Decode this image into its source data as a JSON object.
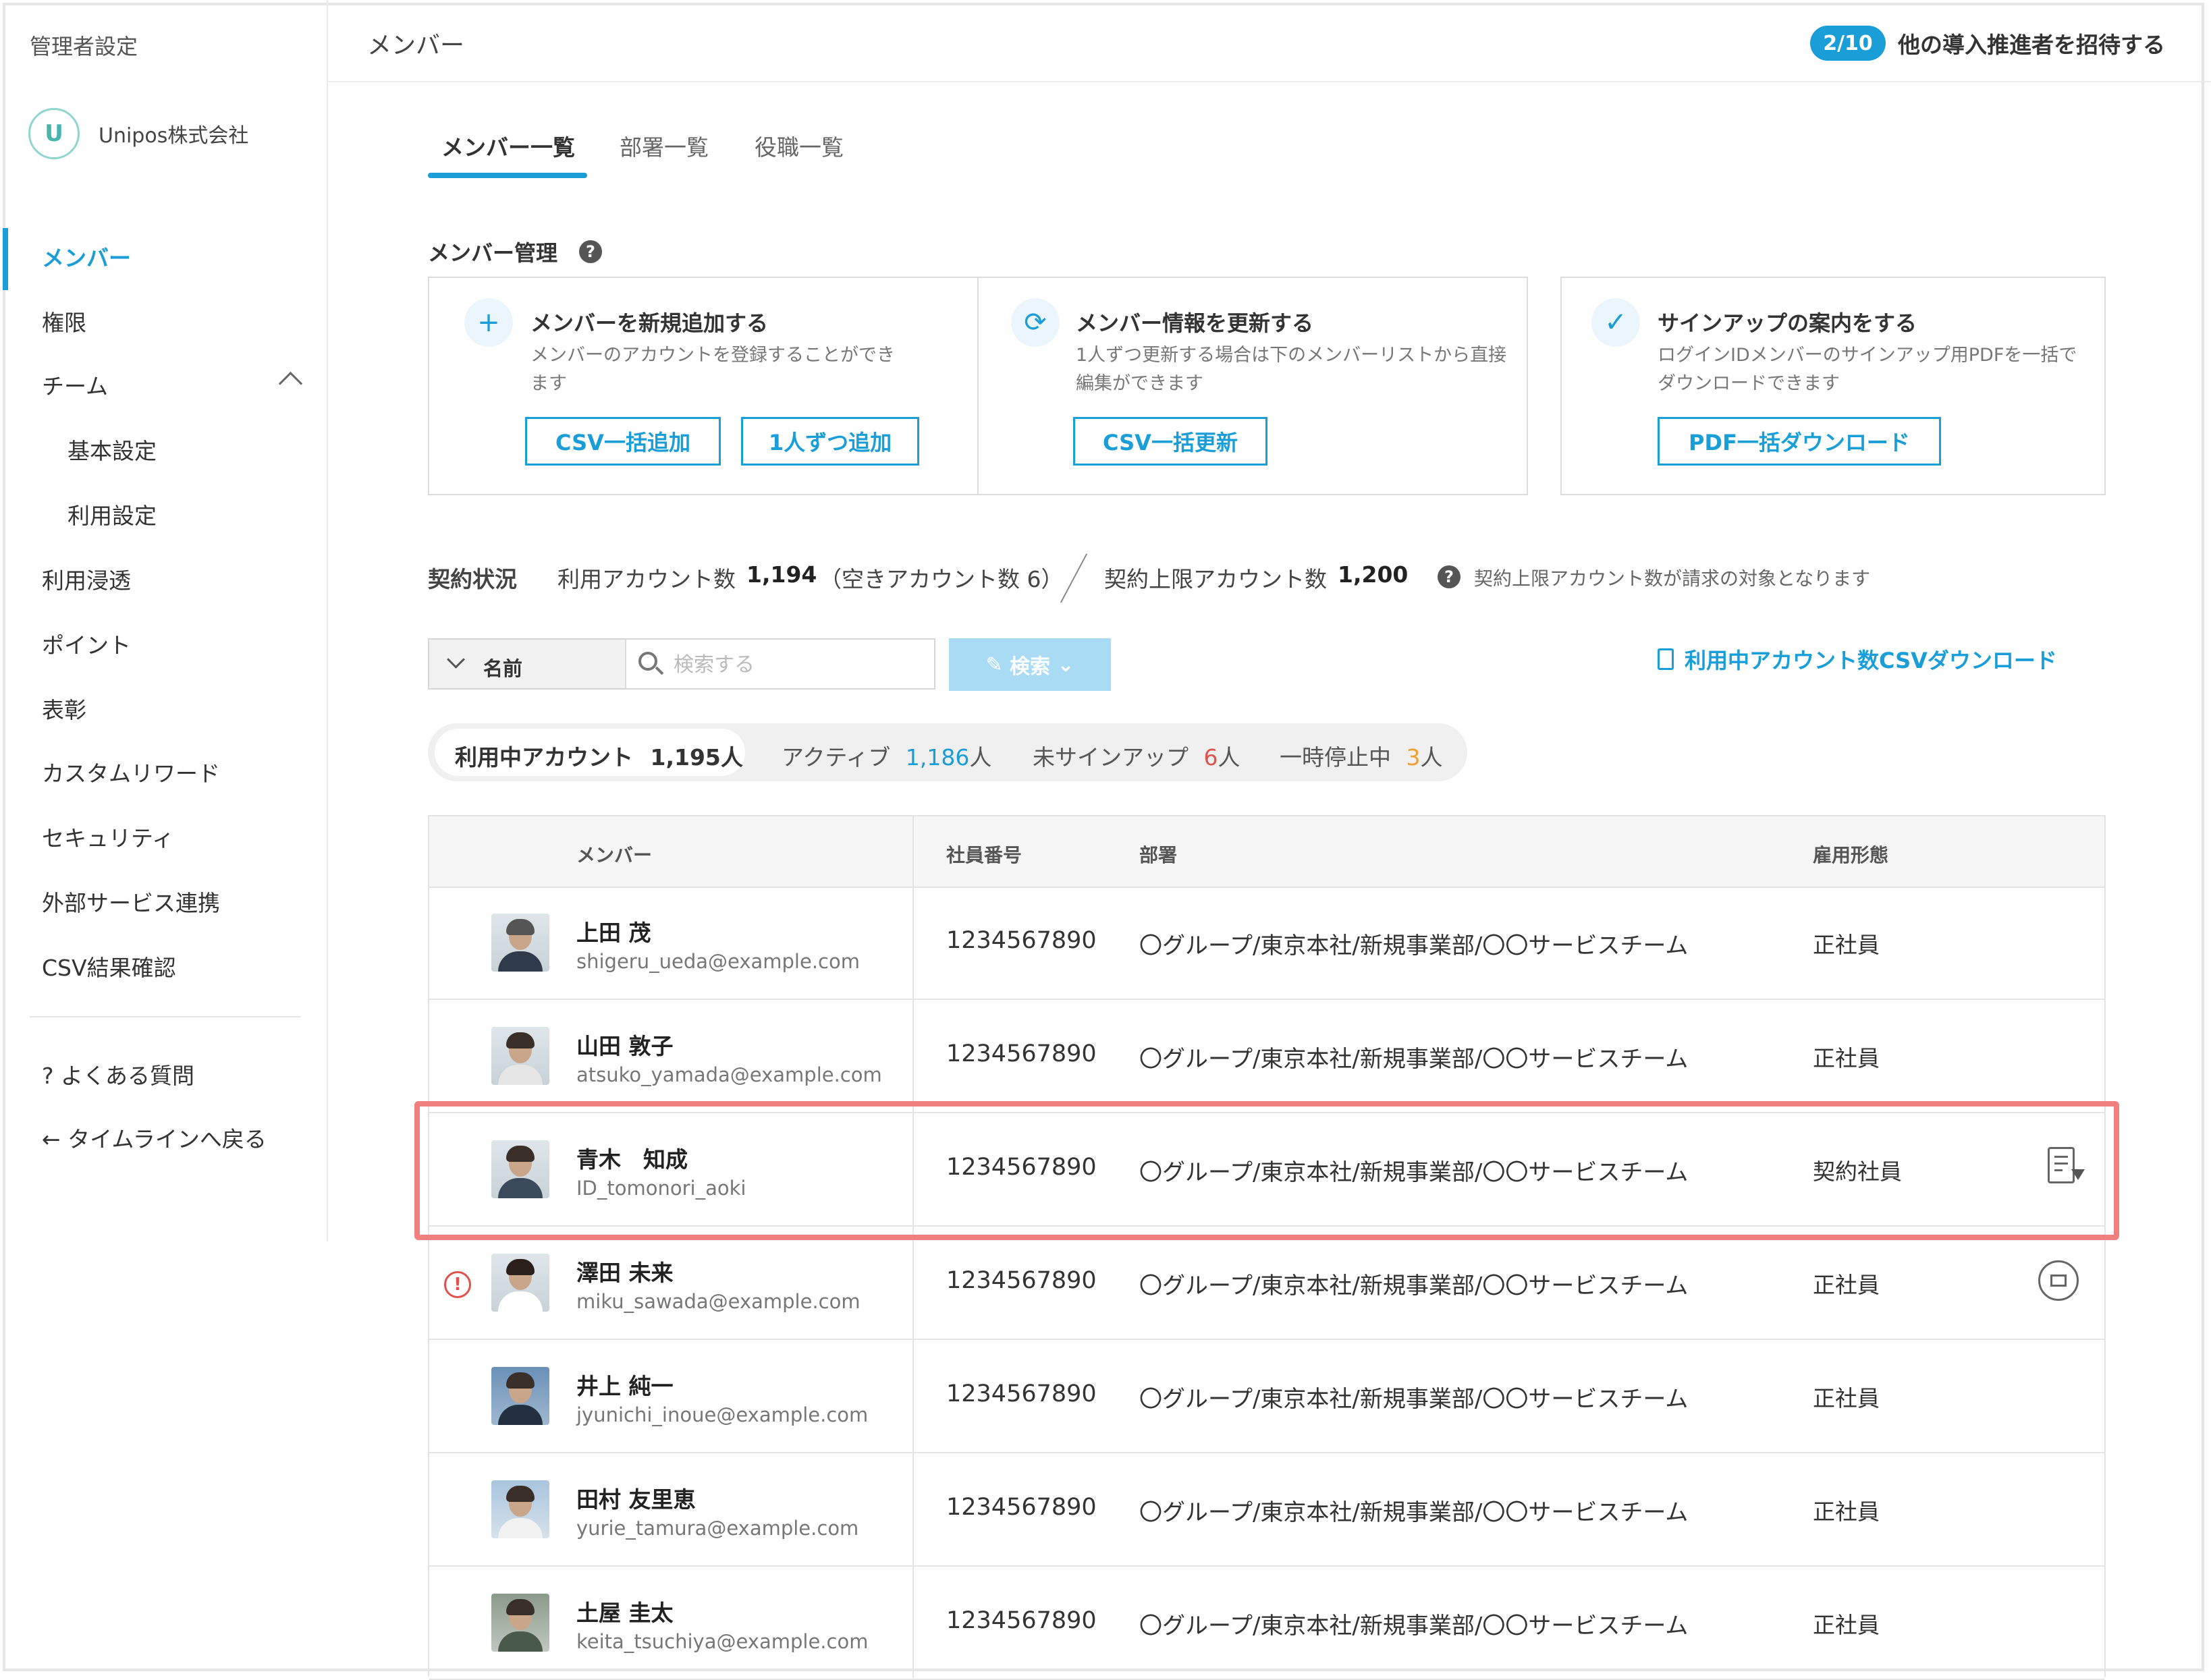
{
  "sidebar": {
    "title": "管理者設定",
    "org_logo": "U",
    "org_name": "Unipos株式会社",
    "items": [
      {
        "label": "メンバー"
      },
      {
        "label": "権限"
      },
      {
        "label": "チーム"
      },
      {
        "label": "基本設定"
      },
      {
        "label": "利用設定"
      },
      {
        "label": "利用浸透"
      },
      {
        "label": "ポイント"
      },
      {
        "label": "表彰"
      },
      {
        "label": "カスタムリワード"
      },
      {
        "label": "セキュリティ"
      },
      {
        "label": "外部サービス連携"
      },
      {
        "label": "CSV結果確認"
      }
    ],
    "faq": "? よくある質問",
    "back": "← タイムラインへ戻る"
  },
  "header": {
    "title": "メンバー",
    "badge": "2/10",
    "invite": "他の導入推進者を招待する"
  },
  "tabs": [
    "メンバー一覧",
    "部署一覧",
    "役職一覧"
  ],
  "management": {
    "label": "メンバー管理",
    "help": "?",
    "cards": [
      {
        "icon": "+",
        "title": "メンバーを新規追加する",
        "desc": "メンバーのアカウントを登録することができます",
        "buttons": [
          "CSV一括追加",
          "1人ずつ追加"
        ]
      },
      {
        "icon": "⟳",
        "title": "メンバー情報を更新する",
        "desc": "1人ずつ更新する場合は下のメンバーリストから直接編集ができます",
        "buttons": [
          "CSV一括更新"
        ]
      },
      {
        "icon": "✓",
        "title": "サインアップの案内をする",
        "desc": "ログインIDメンバーのサインアップ用PDFを一括でダウンロードできます",
        "buttons": [
          "PDF一括ダウンロード"
        ]
      }
    ]
  },
  "contract": {
    "label": "契約状況",
    "used": "利用アカウント数",
    "used_count": "1,194",
    "free": "（空きアカウント数 6）",
    "limit": "契約上限アカウント数",
    "limit_count": "1,200",
    "help": "?",
    "note": "契約上限アカウント数が請求の対象となります"
  },
  "search": {
    "field": "名前",
    "placeholder": "検索する",
    "button": "検索",
    "download": "利用中アカウント数CSVダウンロード"
  },
  "filters": {
    "in_use_label": "利用中アカウント",
    "in_use_count": "1,195人",
    "active_label": "アクティブ",
    "active_count": "1,186",
    "unsigned_label": "未サインアップ",
    "unsigned_count": "6",
    "paused_label": "一時停止中",
    "paused_count": "3",
    "unit": "人"
  },
  "table": {
    "headers": {
      "member": "メンバー",
      "id": "社員番号",
      "dept": "部署",
      "emp": "雇用形態"
    },
    "rows": [
      {
        "name": "上田 茂",
        "email": "shigeru_ueda@example.com",
        "id": "1234567890",
        "dept": "〇グループ/東京本社/新規事業部/〇〇サービスチーム",
        "emp": "正社員"
      },
      {
        "name": "山田 敦子",
        "email": "atsuko_yamada@example.com",
        "id": "1234567890",
        "dept": "〇グループ/東京本社/新規事業部/〇〇サービスチーム",
        "emp": "正社員"
      },
      {
        "name": "青木　知成",
        "email": "ID_tomonori_aoki",
        "id": "1234567890",
        "dept": "〇グループ/東京本社/新規事業部/〇〇サービスチーム",
        "emp": "契約社員"
      },
      {
        "name": "澤田 未来",
        "email": "miku_sawada@example.com",
        "id": "1234567890",
        "dept": "〇グループ/東京本社/新規事業部/〇〇サービスチーム",
        "emp": "正社員"
      },
      {
        "name": "井上 純一",
        "email": "jyunichi_inoue@example.com",
        "id": "1234567890",
        "dept": "〇グループ/東京本社/新規事業部/〇〇サービスチーム",
        "emp": "正社員"
      },
      {
        "name": "田村 友里恵",
        "email": "yurie_tamura@example.com",
        "id": "1234567890",
        "dept": "〇グループ/東京本社/新規事業部/〇〇サービスチーム",
        "emp": "正社員"
      },
      {
        "name": "土屋 圭太",
        "email": "keita_tsuchiya@example.com",
        "id": "1234567890",
        "dept": "〇グループ/東京本社/新規事業部/〇〇サービスチーム",
        "emp": "正社員"
      }
    ],
    "warn_icon": "!"
  },
  "colors": {
    "accent": "#1a9ed8",
    "highlight": "#f08080",
    "warn": "#e0524d",
    "orange": "#f0a030"
  }
}
